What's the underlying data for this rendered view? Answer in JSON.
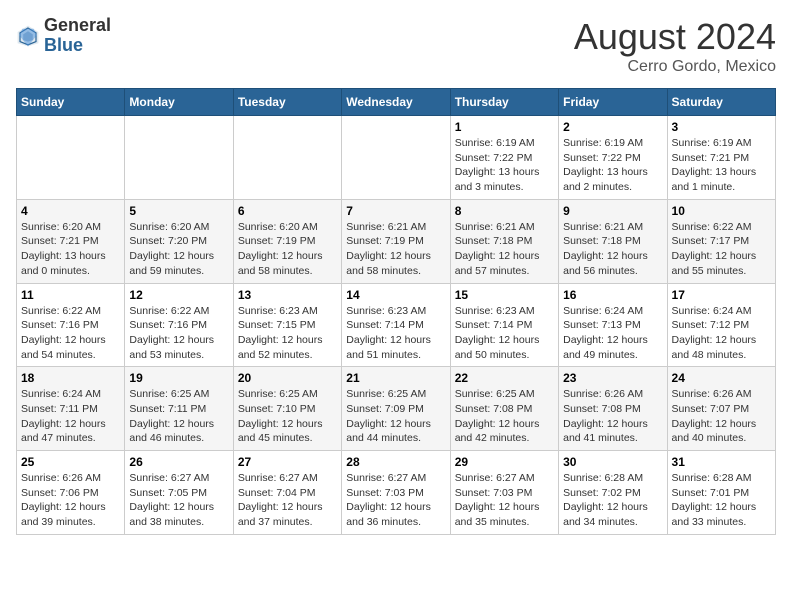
{
  "header": {
    "logo_general": "General",
    "logo_blue": "Blue",
    "month_title": "August 2024",
    "location": "Cerro Gordo, Mexico"
  },
  "weekdays": [
    "Sunday",
    "Monday",
    "Tuesday",
    "Wednesday",
    "Thursday",
    "Friday",
    "Saturday"
  ],
  "weeks": [
    [
      {
        "day": "",
        "info": ""
      },
      {
        "day": "",
        "info": ""
      },
      {
        "day": "",
        "info": ""
      },
      {
        "day": "",
        "info": ""
      },
      {
        "day": "1",
        "info": "Sunrise: 6:19 AM\nSunset: 7:22 PM\nDaylight: 13 hours\nand 3 minutes."
      },
      {
        "day": "2",
        "info": "Sunrise: 6:19 AM\nSunset: 7:22 PM\nDaylight: 13 hours\nand 2 minutes."
      },
      {
        "day": "3",
        "info": "Sunrise: 6:19 AM\nSunset: 7:21 PM\nDaylight: 13 hours\nand 1 minute."
      }
    ],
    [
      {
        "day": "4",
        "info": "Sunrise: 6:20 AM\nSunset: 7:21 PM\nDaylight: 13 hours\nand 0 minutes."
      },
      {
        "day": "5",
        "info": "Sunrise: 6:20 AM\nSunset: 7:20 PM\nDaylight: 12 hours\nand 59 minutes."
      },
      {
        "day": "6",
        "info": "Sunrise: 6:20 AM\nSunset: 7:19 PM\nDaylight: 12 hours\nand 58 minutes."
      },
      {
        "day": "7",
        "info": "Sunrise: 6:21 AM\nSunset: 7:19 PM\nDaylight: 12 hours\nand 58 minutes."
      },
      {
        "day": "8",
        "info": "Sunrise: 6:21 AM\nSunset: 7:18 PM\nDaylight: 12 hours\nand 57 minutes."
      },
      {
        "day": "9",
        "info": "Sunrise: 6:21 AM\nSunset: 7:18 PM\nDaylight: 12 hours\nand 56 minutes."
      },
      {
        "day": "10",
        "info": "Sunrise: 6:22 AM\nSunset: 7:17 PM\nDaylight: 12 hours\nand 55 minutes."
      }
    ],
    [
      {
        "day": "11",
        "info": "Sunrise: 6:22 AM\nSunset: 7:16 PM\nDaylight: 12 hours\nand 54 minutes."
      },
      {
        "day": "12",
        "info": "Sunrise: 6:22 AM\nSunset: 7:16 PM\nDaylight: 12 hours\nand 53 minutes."
      },
      {
        "day": "13",
        "info": "Sunrise: 6:23 AM\nSunset: 7:15 PM\nDaylight: 12 hours\nand 52 minutes."
      },
      {
        "day": "14",
        "info": "Sunrise: 6:23 AM\nSunset: 7:14 PM\nDaylight: 12 hours\nand 51 minutes."
      },
      {
        "day": "15",
        "info": "Sunrise: 6:23 AM\nSunset: 7:14 PM\nDaylight: 12 hours\nand 50 minutes."
      },
      {
        "day": "16",
        "info": "Sunrise: 6:24 AM\nSunset: 7:13 PM\nDaylight: 12 hours\nand 49 minutes."
      },
      {
        "day": "17",
        "info": "Sunrise: 6:24 AM\nSunset: 7:12 PM\nDaylight: 12 hours\nand 48 minutes."
      }
    ],
    [
      {
        "day": "18",
        "info": "Sunrise: 6:24 AM\nSunset: 7:11 PM\nDaylight: 12 hours\nand 47 minutes."
      },
      {
        "day": "19",
        "info": "Sunrise: 6:25 AM\nSunset: 7:11 PM\nDaylight: 12 hours\nand 46 minutes."
      },
      {
        "day": "20",
        "info": "Sunrise: 6:25 AM\nSunset: 7:10 PM\nDaylight: 12 hours\nand 45 minutes."
      },
      {
        "day": "21",
        "info": "Sunrise: 6:25 AM\nSunset: 7:09 PM\nDaylight: 12 hours\nand 44 minutes."
      },
      {
        "day": "22",
        "info": "Sunrise: 6:25 AM\nSunset: 7:08 PM\nDaylight: 12 hours\nand 42 minutes."
      },
      {
        "day": "23",
        "info": "Sunrise: 6:26 AM\nSunset: 7:08 PM\nDaylight: 12 hours\nand 41 minutes."
      },
      {
        "day": "24",
        "info": "Sunrise: 6:26 AM\nSunset: 7:07 PM\nDaylight: 12 hours\nand 40 minutes."
      }
    ],
    [
      {
        "day": "25",
        "info": "Sunrise: 6:26 AM\nSunset: 7:06 PM\nDaylight: 12 hours\nand 39 minutes."
      },
      {
        "day": "26",
        "info": "Sunrise: 6:27 AM\nSunset: 7:05 PM\nDaylight: 12 hours\nand 38 minutes."
      },
      {
        "day": "27",
        "info": "Sunrise: 6:27 AM\nSunset: 7:04 PM\nDaylight: 12 hours\nand 37 minutes."
      },
      {
        "day": "28",
        "info": "Sunrise: 6:27 AM\nSunset: 7:03 PM\nDaylight: 12 hours\nand 36 minutes."
      },
      {
        "day": "29",
        "info": "Sunrise: 6:27 AM\nSunset: 7:03 PM\nDaylight: 12 hours\nand 35 minutes."
      },
      {
        "day": "30",
        "info": "Sunrise: 6:28 AM\nSunset: 7:02 PM\nDaylight: 12 hours\nand 34 minutes."
      },
      {
        "day": "31",
        "info": "Sunrise: 6:28 AM\nSunset: 7:01 PM\nDaylight: 12 hours\nand 33 minutes."
      }
    ]
  ]
}
